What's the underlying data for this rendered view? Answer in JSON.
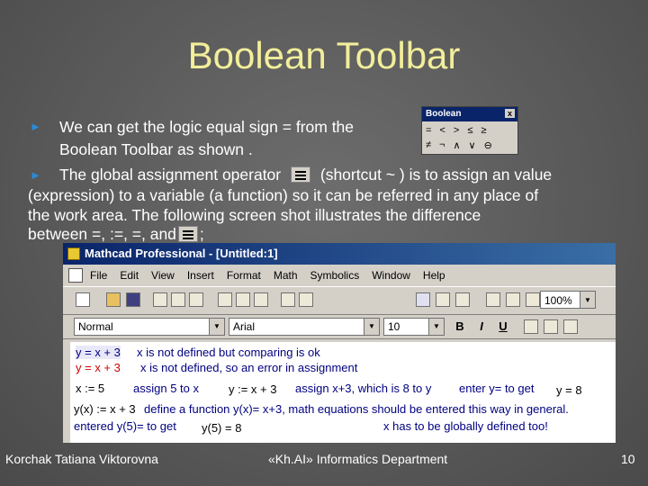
{
  "slide": {
    "title": "Boolean Toolbar",
    "bullets": [
      {
        "line1": "We can get the logic equal sign = from the",
        "line2": "Boolean Toolbar as shown ."
      },
      {
        "part1": "The global assignment operator",
        "part2": "(shortcut ~ ) is to assign an value",
        "line2": "(expression) to a variable (a function) so it can be referred in any place of",
        "line3": "the work area. The following screen shot illustrates the difference",
        "line4_prefix": "between =, :=, =, and",
        "line4_suffix": ";"
      }
    ],
    "bullet_glyph": "►",
    "footer": {
      "author": "Korchak Tatiana Viktorovna",
      "department": "«Kh.AI» Informatics Department",
      "page_number": "10"
    }
  },
  "boolean_toolbar": {
    "title": "Boolean",
    "close_glyph": "x",
    "row1": [
      "=",
      "<",
      ">",
      "≤",
      "≥"
    ],
    "row2": [
      "≠",
      "¬",
      "∧",
      "∨",
      "⊖"
    ]
  },
  "mathcad": {
    "window_title": "Mathcad Professional - [Untitled:1]",
    "menu": [
      "File",
      "Edit",
      "View",
      "Insert",
      "Format",
      "Math",
      "Symbolics",
      "Window",
      "Help"
    ],
    "zoom": "100%",
    "style_select": "Normal",
    "font_select": "Arial",
    "size_select": "10",
    "format_buttons": [
      "B",
      "I",
      "U"
    ],
    "worksheet": {
      "r1_expr": "y = x + 3",
      "r1_note": "x is not defined but comparing is ok",
      "r2_expr": "y = x + 3",
      "r2_note": "x is not defined, so an error in assignment",
      "r3_def": "x := 5",
      "r3_note": "assign 5 to x",
      "r3_expr": "y := x + 3",
      "r3_note2": "assign x+3, which is 8 to y",
      "r3_note3": "enter y= to get",
      "r3_result": "y = 8",
      "r4_def": "y(x) := x + 3",
      "r4_note": "define a function y(x)= x+3, math equations should be entered this way in general.",
      "r5_note": "entered y(5)= to get",
      "r5_result": "y(5) = 8",
      "r5_note2": "x has to be globally defined too!"
    }
  },
  "colors": {
    "title": "#f2ee9a",
    "bullet": "#2a8ad8",
    "text": "#ffffff",
    "background": "#5e5e5e"
  }
}
